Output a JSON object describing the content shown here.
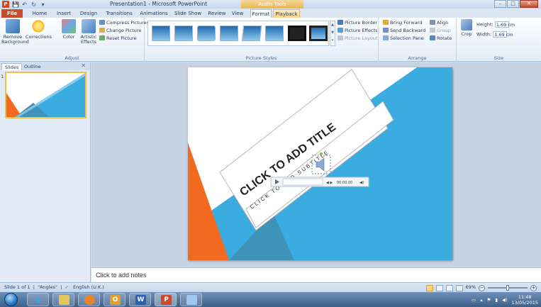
{
  "window": {
    "title": "Presentation1 - Microsoft PowerPoint",
    "contextual_tab_group": "Audio Tools",
    "min_glyph": "–",
    "max_glyph": "□",
    "close_glyph": "✕"
  },
  "qat": {
    "logo": "P",
    "save": "💾",
    "undo": "↶",
    "redo": "↻",
    "more": "▾"
  },
  "tabs": [
    "File",
    "Home",
    "Insert",
    "Design",
    "Transitions",
    "Animations",
    "Slide Show",
    "Review",
    "View",
    "Format",
    "Playback"
  ],
  "help": "?",
  "ribbon": {
    "adjust": {
      "remove_background": "Remove Background",
      "corrections": "Corrections",
      "color": "Color",
      "artistic_effects": "Artistic Effects",
      "compress": "Compress Pictures",
      "change": "Change Picture",
      "reset": "Reset Picture",
      "label": "Adjust"
    },
    "picture_styles": {
      "label": "Picture Styles",
      "border": "Picture Border",
      "effects": "Picture Effects",
      "layout": "Picture Layout"
    },
    "arrange": {
      "label": "Arrange",
      "bring_forward": "Bring Forward",
      "send_backward": "Send Backward",
      "selection_pane": "Selection Pane",
      "align": "Align",
      "group": "Group",
      "rotate": "Rotate"
    },
    "size": {
      "label": "Size",
      "crop": "Crop",
      "height_label": "Height:",
      "height_value": "1.69 cm",
      "width_label": "Width:",
      "width_value": "1.69 cm"
    }
  },
  "left_pane": {
    "tab_slides": "Slides",
    "tab_outline": "Outline",
    "close": "✕",
    "slide_number": "1"
  },
  "slide": {
    "title": "CLICK TO ADD TITLE",
    "subtitle": "CLICK TO ADD SUBTITLE",
    "audio_time": "00:00.00",
    "colors": {
      "orange": "#f26b21",
      "blue": "#3aace0",
      "teal": "#3d93b8"
    }
  },
  "notes_placeholder": "Click to add notes",
  "status": {
    "slide_info": "Slide 1 of 1",
    "theme": "\"Angles\"",
    "language": "English (U.K.)",
    "zoom": "69%"
  },
  "taskbar": {
    "time": "11:48",
    "date": "13/05/2015",
    "outlook": "O",
    "word": "W",
    "powerpoint": "P"
  }
}
